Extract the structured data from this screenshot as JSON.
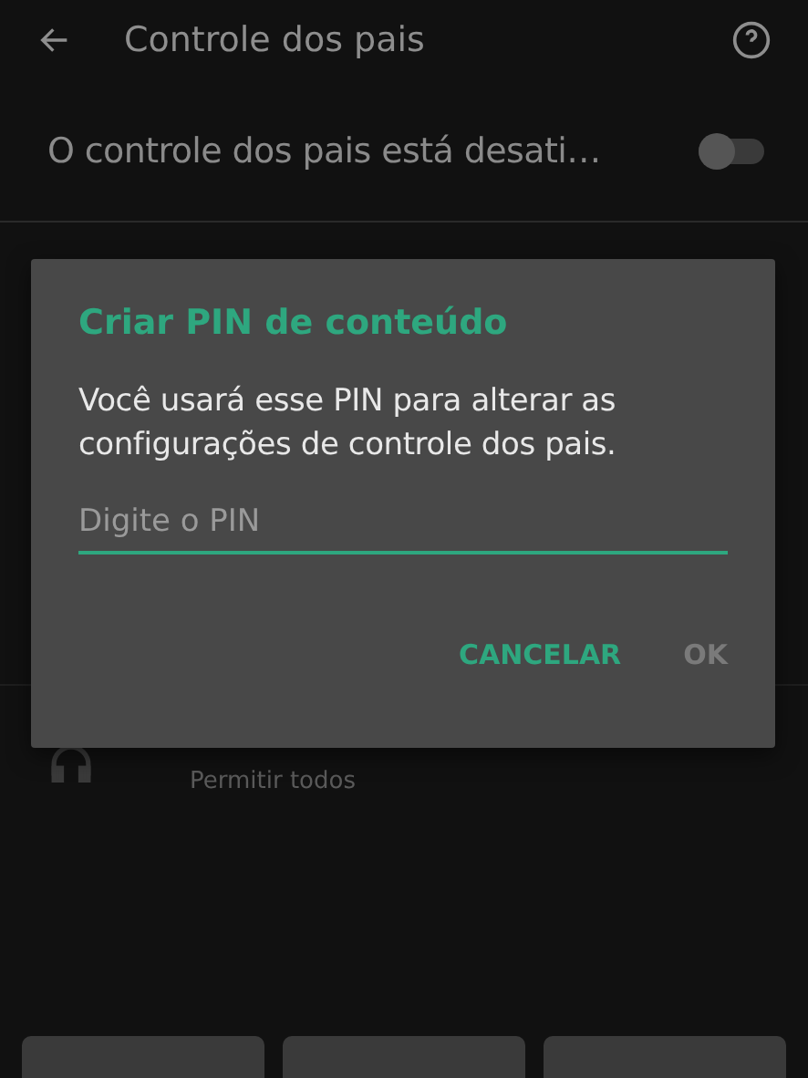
{
  "header": {
    "title": "Controle dos pais"
  },
  "parental_toggle": {
    "label": "O controle dos pais está desati…",
    "on": false
  },
  "list_item": {
    "subtitle": "Permitir todos"
  },
  "dialog": {
    "title": "Criar PIN de conteúdo",
    "message": "Você usará esse PIN para alterar as configurações de controle dos pais.",
    "pin_field": {
      "placeholder": "Digite o PIN"
    },
    "buttons": [
      {
        "label": "CANCELAR",
        "disabled": false
      },
      {
        "label": "OK",
        "disabled": true
      }
    ]
  }
}
